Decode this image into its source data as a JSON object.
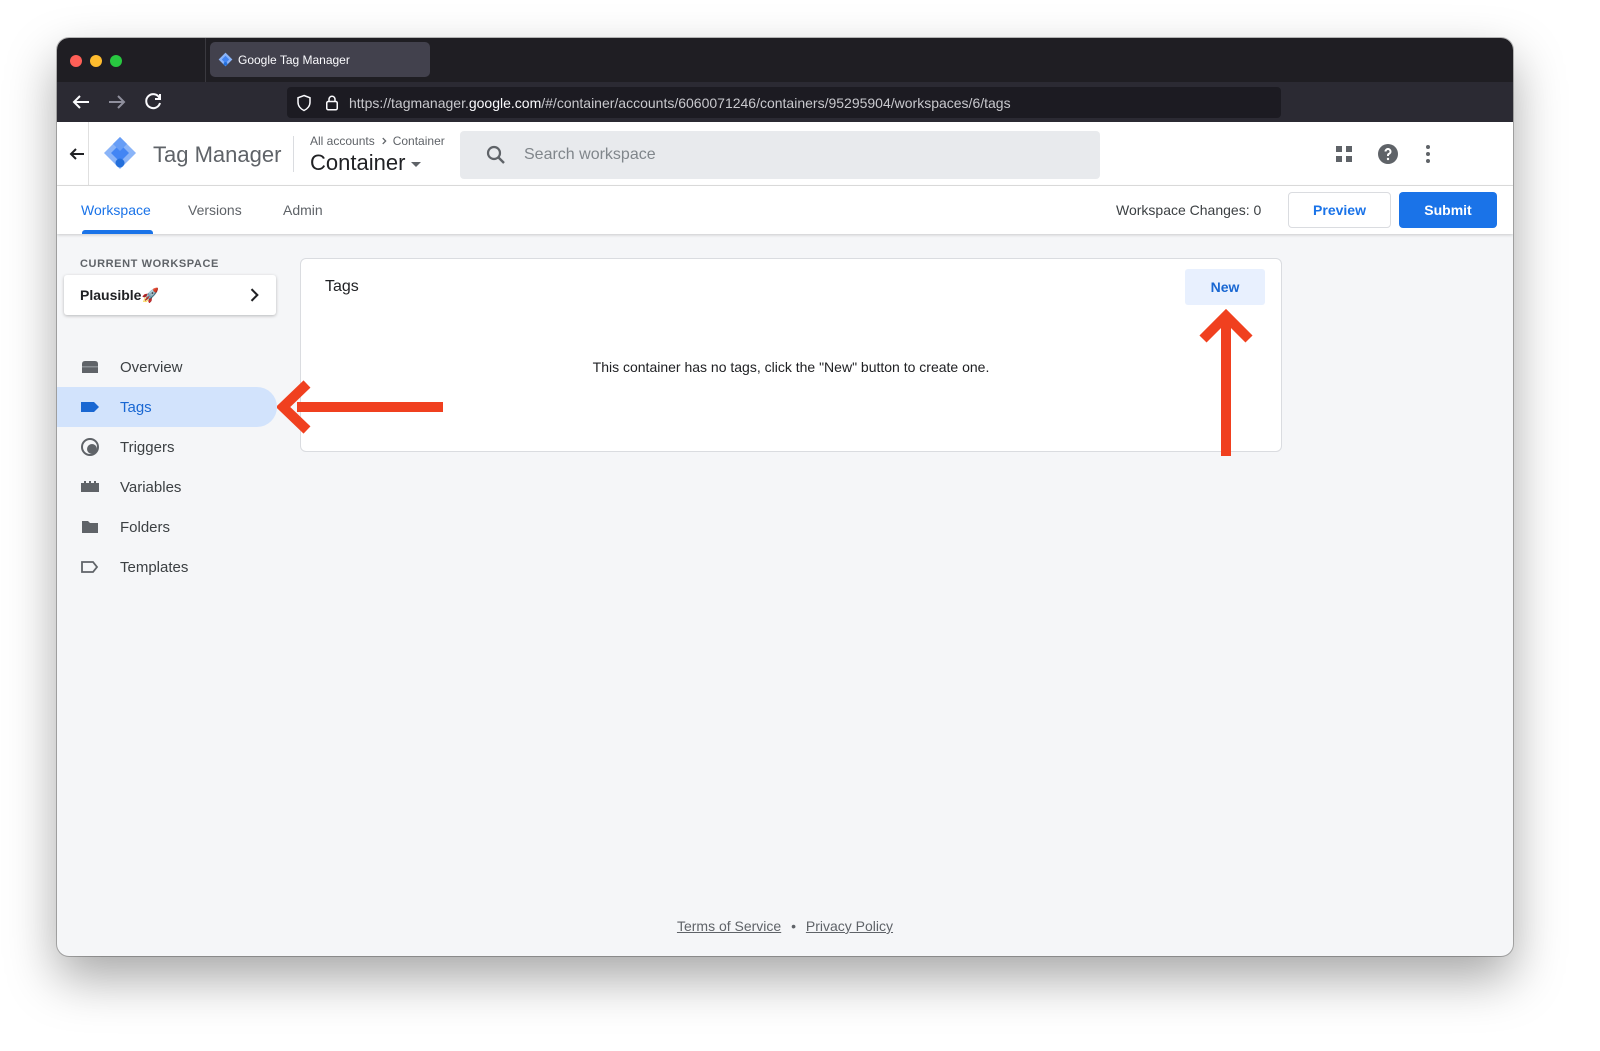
{
  "browser": {
    "tab_title": "Google Tag Manager",
    "url_prefix": "https://tagmanager.",
    "url_host": "google.com",
    "url_path": "/#/container/accounts/6060071246/containers/95295904/workspaces/6/tags"
  },
  "header": {
    "product_name": "Tag Manager",
    "breadcrumb_accounts": "All accounts",
    "breadcrumb_container": "Container",
    "container_name": "Container",
    "search_placeholder": "Search workspace"
  },
  "subnav": {
    "tabs": [
      {
        "label": "Workspace",
        "active": true
      },
      {
        "label": "Versions",
        "active": false
      },
      {
        "label": "Admin",
        "active": false
      }
    ],
    "workspace_changes": "Workspace Changes: 0",
    "preview_label": "Preview",
    "submit_label": "Submit"
  },
  "sidebar": {
    "current_workspace_label": "CURRENT WORKSPACE",
    "workspace_name": "Plausible🚀",
    "items": [
      {
        "label": "Overview",
        "icon": "overview-icon",
        "active": false
      },
      {
        "label": "Tags",
        "icon": "tag-icon",
        "active": true
      },
      {
        "label": "Triggers",
        "icon": "trigger-icon",
        "active": false
      },
      {
        "label": "Variables",
        "icon": "variables-icon",
        "active": false
      },
      {
        "label": "Folders",
        "icon": "folder-icon",
        "active": false
      },
      {
        "label": "Templates",
        "icon": "template-icon",
        "active": false
      }
    ]
  },
  "main": {
    "card_title": "Tags",
    "new_label": "New",
    "empty_message": "This container has no tags, click the \"New\" button to create one."
  },
  "footer": {
    "terms": "Terms of Service",
    "separator": "•",
    "privacy": "Privacy Policy"
  },
  "colors": {
    "accent": "#1a73e8",
    "active_nav_bg": "#d2e3fc",
    "annotation_arrow": "#f0401f"
  }
}
